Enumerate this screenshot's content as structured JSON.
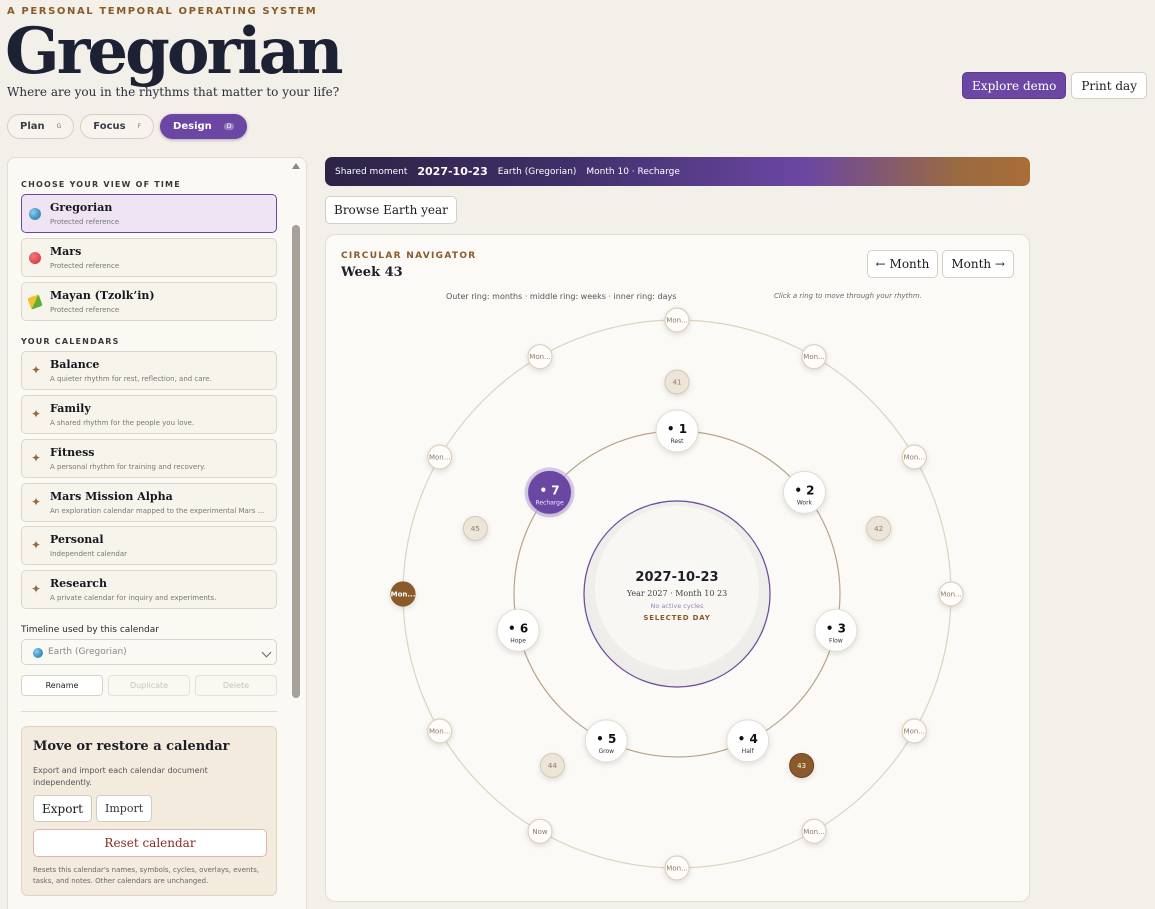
{
  "header": {
    "eyebrow": "A PERSONAL TEMPORAL OPERATING SYSTEM",
    "title": "Gregorian",
    "tagline": "Where are you in the rhythms that matter to your life?",
    "modes": [
      {
        "label": "Plan",
        "key": "G"
      },
      {
        "label": "Focus",
        "key": "F"
      },
      {
        "label": "Design",
        "key": "D",
        "active": true
      }
    ],
    "explore_demo": "Explore demo",
    "print_day": "Print day"
  },
  "sidebar": {
    "view_label": "CHOOSE YOUR VIEW OF TIME",
    "views": [
      {
        "name": "Gregorian",
        "desc": "Protected reference",
        "icon": "earth-icon",
        "selected": true
      },
      {
        "name": "Mars",
        "desc": "Protected reference",
        "icon": "mars-icon"
      },
      {
        "name": "Mayan (Tzolk’in)",
        "desc": "Protected reference",
        "icon": "corn-icon"
      }
    ],
    "calendars_label": "YOUR CALENDARS",
    "calendars": [
      {
        "name": "Balance",
        "desc": "A quieter rhythm for rest, reflection, and care."
      },
      {
        "name": "Family",
        "desc": "A shared rhythm for the people you love."
      },
      {
        "name": "Fitness",
        "desc": "A personal rhythm for training and recovery."
      },
      {
        "name": "Mars Mission Alpha",
        "desc": "An exploration calendar mapped to the experimental Mars ..."
      },
      {
        "name": "Personal",
        "desc": "Independent calendar"
      },
      {
        "name": "Research",
        "desc": "A private calendar for inquiry and experiments."
      }
    ],
    "timeline_label": "Timeline used by this calendar",
    "timeline_value": "Earth (Gregorian)",
    "rename": "Rename",
    "duplicate": "Duplicate",
    "delete": "Delete",
    "move": {
      "title": "Move or restore a calendar",
      "body": "Export and import each calendar document independently.",
      "export": "Export",
      "import": "Import",
      "reset": "Reset calendar",
      "foot": "Resets this calendar's names, symbols, cycles, overlays, events, tasks, and notes. Other calendars are unchanged."
    }
  },
  "moment": {
    "label": "Shared moment",
    "date": "2027-10-23",
    "timeline": "Earth (Gregorian)",
    "month": "Month 10 · Recharge"
  },
  "browse_year": "Browse Earth year",
  "navigator": {
    "eyebrow": "CIRCULAR NAVIGATOR",
    "week": "Week 43",
    "prev": "← Month",
    "next": "Month →",
    "caption": "Outer ring: months · middle ring: weeks · inner ring: days",
    "hint": "Click a ring to move through your rhythm.",
    "center": {
      "date": "2027-10-23",
      "sub": "Year 2027 · Month 10 23",
      "cycles": "No active cycles",
      "tag": "SELECTED DAY"
    },
    "month_nodes": [
      "Mon...",
      "Mon...",
      "Mon...",
      "Mon...",
      "Mon...",
      "Mon...",
      "Mon...",
      "Now",
      "Mon...",
      "Mon...",
      "Mon...",
      "Mon..."
    ],
    "week_nodes": [
      "41",
      "42",
      "43",
      "44",
      "45"
    ],
    "day_nodes": [
      {
        "num": "1",
        "label": "Rest"
      },
      {
        "num": "2",
        "label": "Work"
      },
      {
        "num": "3",
        "label": "Flow"
      },
      {
        "num": "4",
        "label": "Half"
      },
      {
        "num": "5",
        "label": "Grow"
      },
      {
        "num": "6",
        "label": "Hope"
      },
      {
        "num": "7",
        "label": "Recharge"
      }
    ],
    "colors": {
      "accent": "#6b47a3",
      "bronze": "#8a5a2b"
    }
  }
}
